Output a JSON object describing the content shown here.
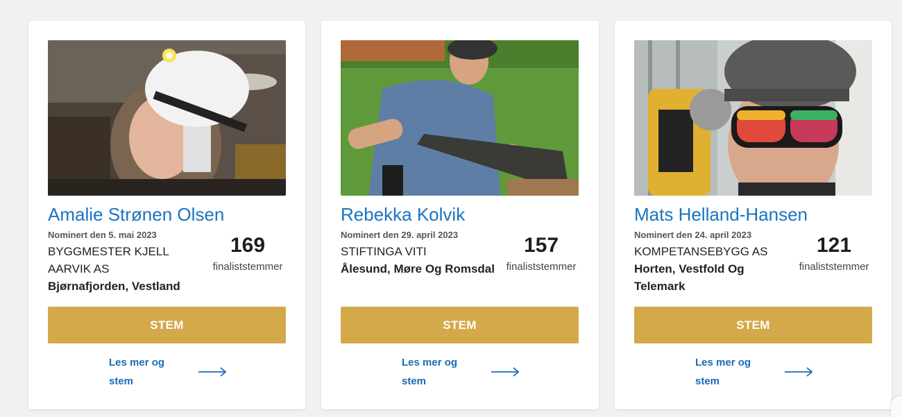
{
  "candidates": [
    {
      "name": "Amalie Strønen Olsen",
      "nominated": "Nominert den 5. mai 2023",
      "company": "BYGGMESTER KJELL AARVIK AS",
      "location": "Bjørnafjorden, Vestland",
      "votes": "169",
      "votes_label": "finaliststemmer",
      "photo_alt": "hard-hat-headlamp-portrait"
    },
    {
      "name": "Rebekka Kolvik",
      "nominated": "Nominert den 29. april 2023",
      "company": "STIFTINGA VITI",
      "location": "Ålesund, Møre Og Romsdal",
      "votes": "157",
      "votes_label": "finaliststemmer",
      "photo_alt": "woman-sawing-log"
    },
    {
      "name": "Mats Helland-Hansen",
      "nominated": "Nominert den 24. april 2023",
      "company": "KOMPETANSEBYGG AS",
      "location": "Horten, Vestfold Og Telemark",
      "votes": "121",
      "votes_label": "finaliststemmer",
      "photo_alt": "man-with-angle-grinder"
    }
  ],
  "vote_button_label": "STEM",
  "read_more_label": "Les mer og stem",
  "icons": {
    "read_more": "arrow-right-icon"
  },
  "colors": {
    "accent": "#d4a94a",
    "name_link": "#1a73c1",
    "background": "#f1f1f1"
  }
}
